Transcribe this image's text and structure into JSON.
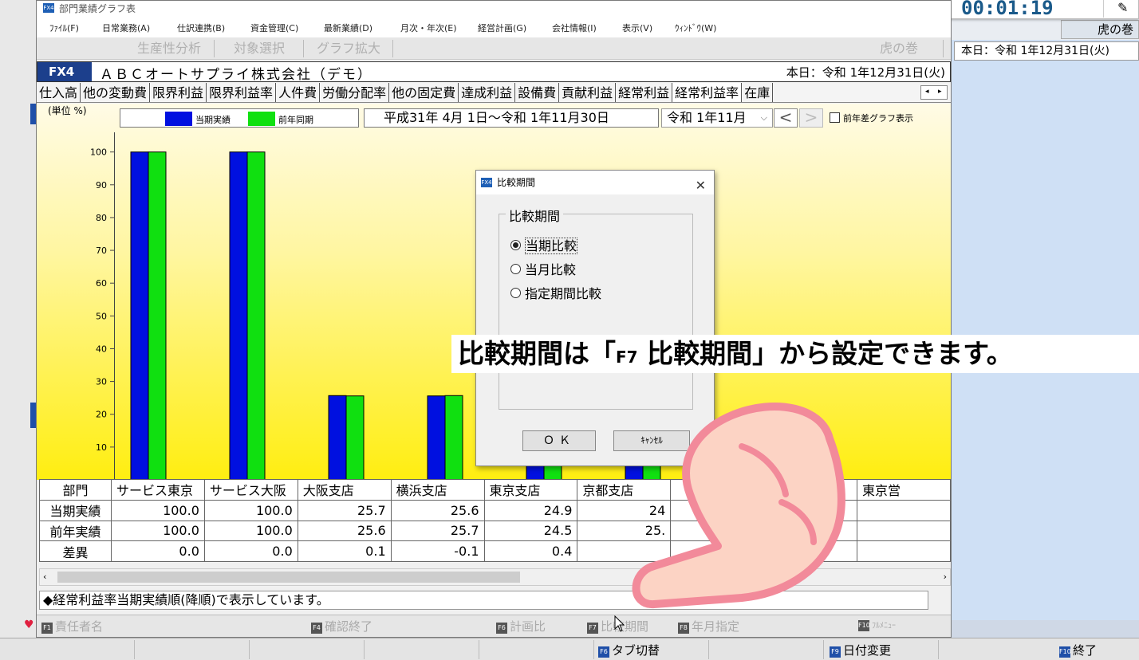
{
  "window": {
    "title": "部門業績グラフ表",
    "icon_label": "FX4"
  },
  "menu": [
    "ﾌｧｲﾙ(F)",
    "日常業務(A)",
    "仕訳連携(B)",
    "資金管理(C)",
    "最新業績(D)",
    "月次・年次(E)",
    "経営計画(G)",
    "会社情報(I)",
    "表示(V)",
    "ｳｨﾝﾄﾞｳ(W)"
  ],
  "toolbar": {
    "productivity": "生産性分析",
    "target_select": "対象選択",
    "graph_zoom": "グラフ拡大",
    "tora": "虎の巻"
  },
  "company": {
    "code": "FX4",
    "name": "ＡＢＣオートサプライ株式会社（デモ）",
    "today": "本日：令和 1年12月31日(火)"
  },
  "tabs": [
    "仕入高",
    "他の変動費",
    "限界利益",
    "限界利益率",
    "人件費",
    "労働分配率",
    "他の固定費",
    "達成利益",
    "設備費",
    "貢献利益",
    "経常利益",
    "経常利益率",
    "在庫"
  ],
  "active_tab": "経常利益率",
  "chart_header": {
    "unit": "(単位 %)",
    "period": "平成31年 4月 1日～令和 1年11月30日",
    "month_select": "令和 1年11月",
    "prev_btn": "<",
    "next_btn": ">",
    "diff_graph_label": "前年差グラフ表示"
  },
  "colors": {
    "current": "#0010e0",
    "previous": "#10e010",
    "company_code_bg": "#1c3f8c"
  },
  "chart_data": {
    "type": "bar",
    "categories": [
      "サービス東京",
      "サービス大阪",
      "大阪支店",
      "横浜支店",
      "東京支店",
      "京都支店"
    ],
    "series": [
      {
        "name": "当期実績",
        "values": [
          100.0,
          100.0,
          25.7,
          25.6,
          24.9,
          24.5
        ]
      },
      {
        "name": "前年同期",
        "values": [
          100.0,
          100.0,
          25.6,
          25.7,
          24.5,
          25.0
        ]
      }
    ],
    "yticks": [
      0,
      10,
      20,
      30,
      40,
      50,
      60,
      70,
      80,
      90,
      100
    ],
    "ylim": [
      0,
      106
    ],
    "legend": "top-left"
  },
  "table": {
    "headers": [
      "部門",
      "サービス東京",
      "サービス大阪",
      "大阪支店",
      "横浜支店",
      "東京支店",
      "京都支店",
      "",
      "",
      "東京営"
    ],
    "rows": [
      {
        "label": "当期実績",
        "cells": [
          "100.0",
          "100.0",
          "25.7",
          "25.6",
          "24.9",
          "24",
          "",
          "",
          ""
        ]
      },
      {
        "label": "前年実績",
        "cells": [
          "100.0",
          "100.0",
          "25.6",
          "25.7",
          "24.5",
          "25.",
          "",
          "",
          ""
        ]
      },
      {
        "label": "差異",
        "cells": [
          "0.0",
          "0.0",
          "0.1",
          "-0.1",
          "0.4",
          "",
          "",
          "",
          ""
        ]
      }
    ]
  },
  "status": "◆経常利益率当期実績順(降順)で表示しています。",
  "fkeys": {
    "f1": "責任者名",
    "f4": "確認終了",
    "f6": "計画比",
    "f7": "比較期間",
    "f8": "年月指定",
    "f10": "ﾌﾙﾒﾆｭｰ"
  },
  "bottom_keys": {
    "f6": "タブ切替",
    "f9": "日付変更",
    "f10": "終了"
  },
  "key_labels": {
    "f1": "F1",
    "f4": "F4",
    "f6": "F6",
    "f7": "F7",
    "f8": "F8",
    "f9": "F9",
    "f10": "F10"
  },
  "dialog": {
    "title": "比較期間",
    "group": "比較期間",
    "options": [
      "当期比較",
      "当月比較",
      "指定期間比較"
    ],
    "selected": 0,
    "ok": "ＯＫ",
    "cancel": "ｷｬﾝｾﾙ"
  },
  "caption": {
    "pre": "比較期間は「",
    "key": "F7",
    "post": " 比較期間」から設定できます。"
  },
  "recording": {
    "time": "00:01:19"
  },
  "background": {
    "today": "本日：令和 1年12月31日(火)",
    "tab": "虎の巻"
  }
}
